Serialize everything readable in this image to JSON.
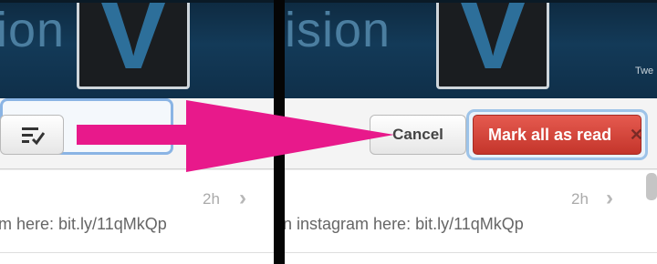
{
  "left": {
    "banner": {
      "brand_fragment": "ion",
      "logo_letter": "V"
    },
    "row": {
      "time": "2h",
      "message": "m here: bit.ly/11qMkQp"
    }
  },
  "right": {
    "banner": {
      "brand_fragment": "ision",
      "logo_letter": "V",
      "small_text": "Twe"
    },
    "toolbar": {
      "cancel_label": "Cancel",
      "mark_all_label": "Mark all as read",
      "close_glyph": "✕"
    },
    "row": {
      "time": "2h",
      "message": "n instagram here: bit.ly/11qMkQp"
    }
  },
  "icons": {
    "compose": "checklist-icon",
    "chevron": "chevron-right-icon",
    "arrow": "magenta-arrow-annotation"
  },
  "colors": {
    "arrow": "#e8198b",
    "mark_all": "#d9443a",
    "focus_ring": "#8ab4e4"
  }
}
